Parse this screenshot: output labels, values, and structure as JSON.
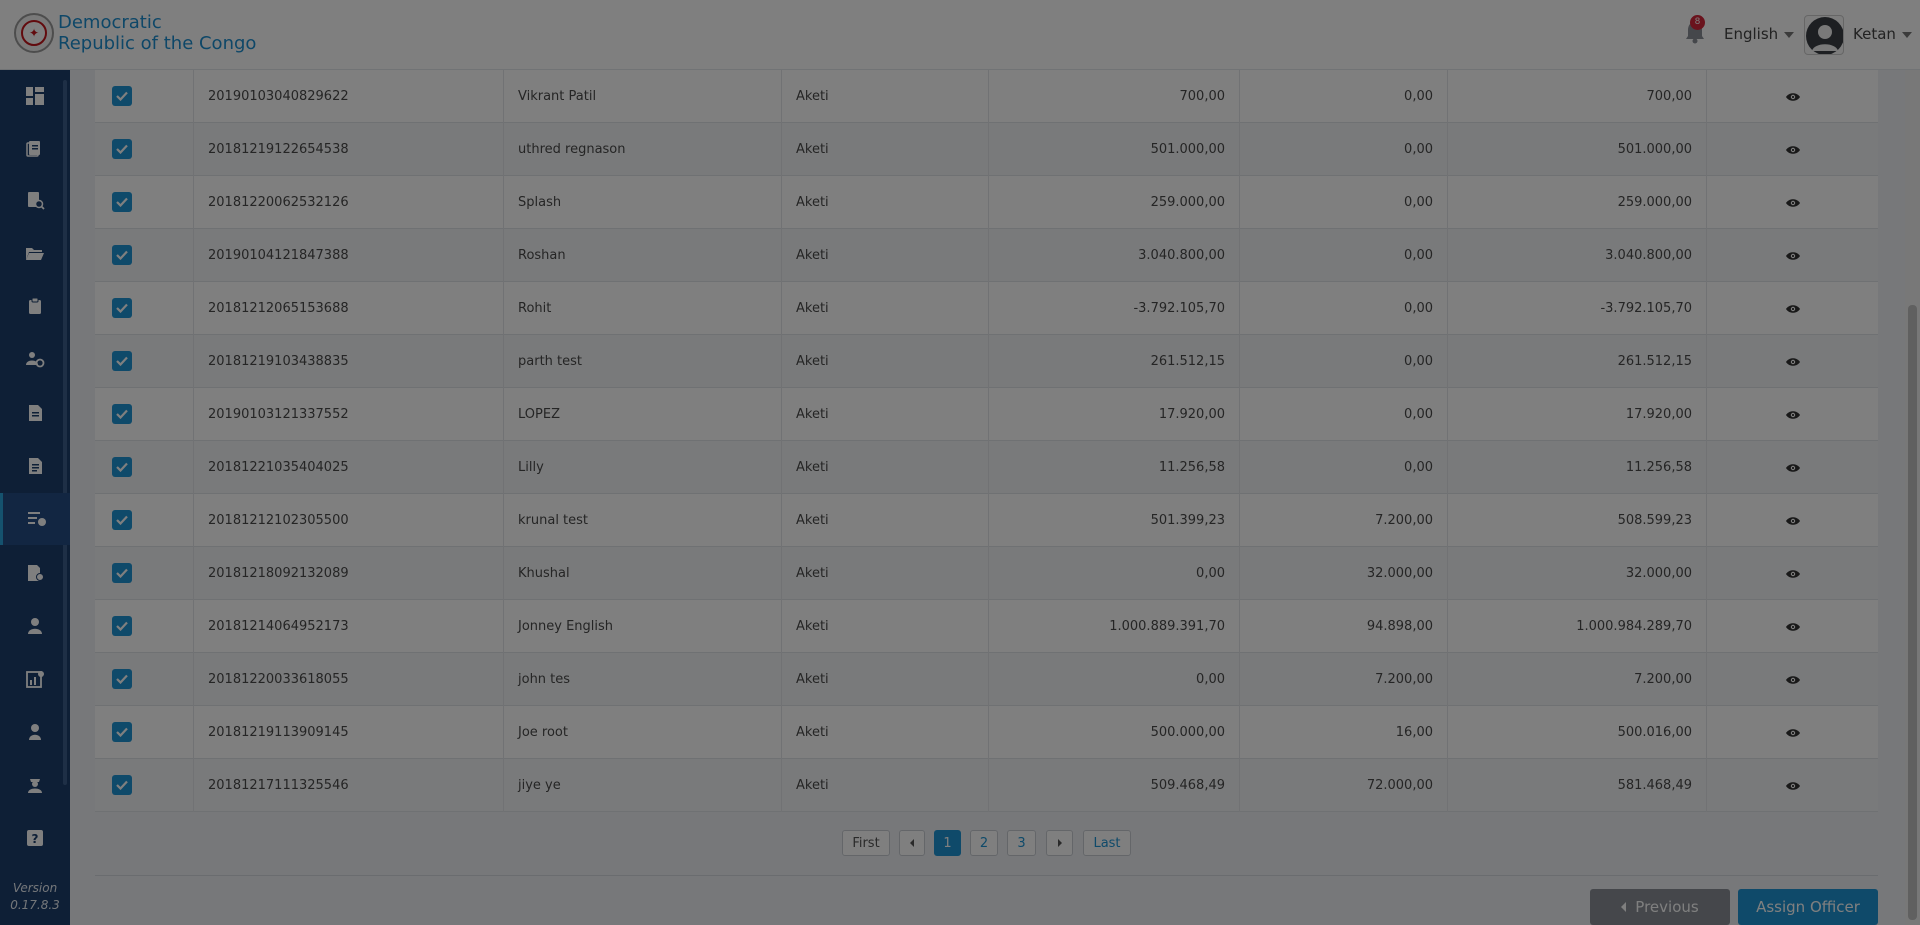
{
  "header": {
    "brand_line1": "Democratic",
    "brand_line2": "Republic of the Congo",
    "notification_count": "8",
    "language": "English",
    "user_name": "Ketan",
    "logo_icon": "coat-of-arms-logo"
  },
  "sidebar": {
    "items": [
      {
        "icon": "dashboard-icon",
        "active": false
      },
      {
        "icon": "documents-icon",
        "active": false
      },
      {
        "icon": "document-search-icon",
        "active": false
      },
      {
        "icon": "folder-open-icon",
        "active": false
      },
      {
        "icon": "clipboard-icon",
        "active": false
      },
      {
        "icon": "settings-users-icon",
        "active": false
      },
      {
        "icon": "report-icon",
        "active": false
      },
      {
        "icon": "report-list-icon",
        "active": false
      },
      {
        "icon": "assignment-icon",
        "active": true
      },
      {
        "icon": "document-user-icon",
        "active": false
      },
      {
        "icon": "user-icon",
        "active": false
      },
      {
        "icon": "chart-settings-icon",
        "active": false
      },
      {
        "icon": "person-icon",
        "active": false
      },
      {
        "icon": "officer-icon",
        "active": false
      },
      {
        "icon": "help-icon",
        "active": false
      }
    ],
    "version_label": "Version",
    "version_number": "0.17.8.3"
  },
  "table": {
    "rows": [
      {
        "id": "20190103040829622",
        "name": "Vikrant Patil",
        "location": "Aketi",
        "v1": "700,00",
        "v2": "0,00",
        "v3": "700,00",
        "checked": true
      },
      {
        "id": "20181219122654538",
        "name": "uthred regnason",
        "location": "Aketi",
        "v1": "501.000,00",
        "v2": "0,00",
        "v3": "501.000,00",
        "checked": true
      },
      {
        "id": "20181220062532126",
        "name": "Splash",
        "location": "Aketi",
        "v1": "259.000,00",
        "v2": "0,00",
        "v3": "259.000,00",
        "checked": true
      },
      {
        "id": "20190104121847388",
        "name": "Roshan",
        "location": "Aketi",
        "v1": "3.040.800,00",
        "v2": "0,00",
        "v3": "3.040.800,00",
        "checked": true
      },
      {
        "id": "20181212065153688",
        "name": "Rohit",
        "location": "Aketi",
        "v1": "-3.792.105,70",
        "v2": "0,00",
        "v3": "-3.792.105,70",
        "checked": true
      },
      {
        "id": "20181219103438835",
        "name": "parth test",
        "location": "Aketi",
        "v1": "261.512,15",
        "v2": "0,00",
        "v3": "261.512,15",
        "checked": true
      },
      {
        "id": "20190103121337552",
        "name": "LOPEZ",
        "location": "Aketi",
        "v1": "17.920,00",
        "v2": "0,00",
        "v3": "17.920,00",
        "checked": true
      },
      {
        "id": "20181221035404025",
        "name": "Lilly",
        "location": "Aketi",
        "v1": "11.256,58",
        "v2": "0,00",
        "v3": "11.256,58",
        "checked": true
      },
      {
        "id": "20181212102305500",
        "name": "krunal test",
        "location": "Aketi",
        "v1": "501.399,23",
        "v2": "7.200,00",
        "v3": "508.599,23",
        "checked": true
      },
      {
        "id": "20181218092132089",
        "name": "Khushal",
        "location": "Aketi",
        "v1": "0,00",
        "v2": "32.000,00",
        "v3": "32.000,00",
        "checked": true
      },
      {
        "id": "20181214064952173",
        "name": "Jonney English",
        "location": "Aketi",
        "v1": "1.000.889.391,70",
        "v2": "94.898,00",
        "v3": "1.000.984.289,70",
        "checked": true
      },
      {
        "id": "20181220033618055",
        "name": "john tes",
        "location": "Aketi",
        "v1": "0,00",
        "v2": "7.200,00",
        "v3": "7.200,00",
        "checked": true
      },
      {
        "id": "20181219113909145",
        "name": "Joe root",
        "location": "Aketi",
        "v1": "500.000,00",
        "v2": "16,00",
        "v3": "500.016,00",
        "checked": true
      },
      {
        "id": "20181217111325546",
        "name": "jiye ye",
        "location": "Aketi",
        "v1": "509.468,49",
        "v2": "72.000,00",
        "v3": "581.468,49",
        "checked": true
      }
    ]
  },
  "pagination": {
    "first": "First",
    "last": "Last",
    "pages": [
      "1",
      "2",
      "3"
    ],
    "current_page": "1"
  },
  "actions": {
    "previous": "Previous",
    "assign": "Assign Officer"
  },
  "colors": {
    "accent": "#1e95d4",
    "sidebar": "#1d3e6d",
    "badge": "#d4263a"
  }
}
